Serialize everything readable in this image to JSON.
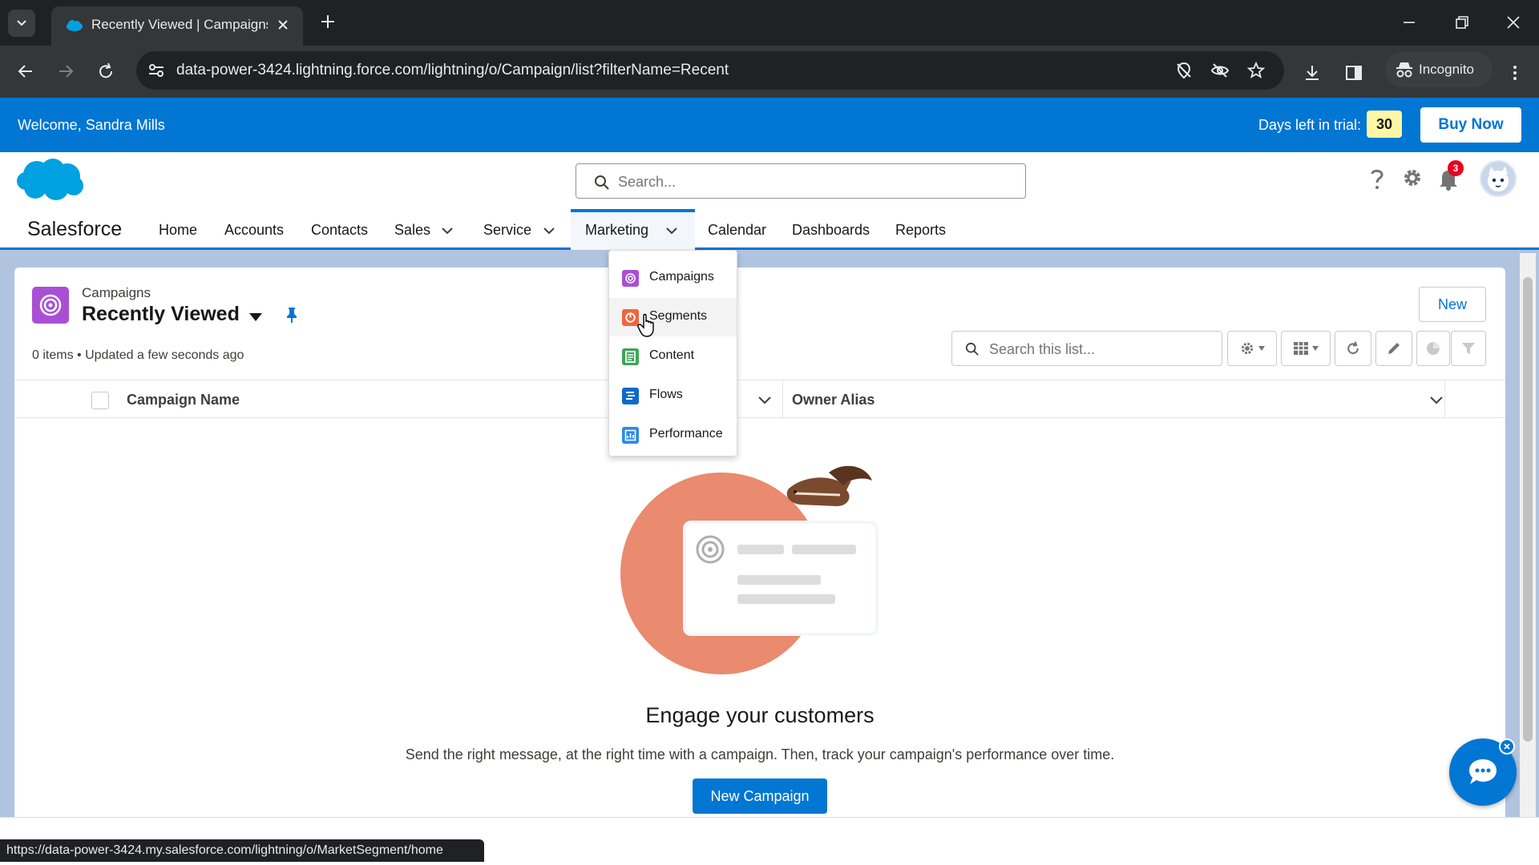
{
  "browser": {
    "tab_title": "Recently Viewed | Campaigns |",
    "url": "data-power-3424.lightning.force.com/lightning/o/Campaign/list?filterName=Recent",
    "incognito_label": "Incognito",
    "status_url": "https://data-power-3424.my.salesforce.com/lightning/o/MarketSegment/home"
  },
  "trial": {
    "welcome": "Welcome, Sandra Mills",
    "days_label": "Days left in trial:",
    "days": "30",
    "buy": "Buy Now"
  },
  "header": {
    "search_placeholder": "Search...",
    "notifications": "3",
    "app_name": "Salesforce"
  },
  "nav": {
    "home": "Home",
    "accounts": "Accounts",
    "contacts": "Contacts",
    "sales": "Sales",
    "service": "Service",
    "marketing": "Marketing",
    "calendar": "Calendar",
    "dashboards": "Dashboards",
    "reports": "Reports"
  },
  "marketing_menu": {
    "items": [
      {
        "label": "Campaigns",
        "color": "#a94fd6"
      },
      {
        "label": "Segments",
        "color": "#f0653d"
      },
      {
        "label": "Content",
        "color": "#3ba755"
      },
      {
        "label": "Flows",
        "color": "#0b6bcb"
      },
      {
        "label": "Performance",
        "color": "#2b8ae6"
      }
    ]
  },
  "list": {
    "object_label": "Campaigns",
    "view_name": "Recently Viewed",
    "meta": "0 items • Updated a few seconds ago",
    "new_label": "New",
    "search_placeholder": "Search this list...",
    "columns": [
      "Campaign Name",
      "Owner Alias"
    ]
  },
  "empty": {
    "title": "Engage your customers",
    "description": "Send the right message, at the right time with a campaign. Then, track your campaign's performance over time.",
    "button": "New Campaign"
  },
  "colors": {
    "brand": "#0176d3",
    "campaign_icon": "#a94fd6",
    "trial_badge": "#fff6a5"
  }
}
